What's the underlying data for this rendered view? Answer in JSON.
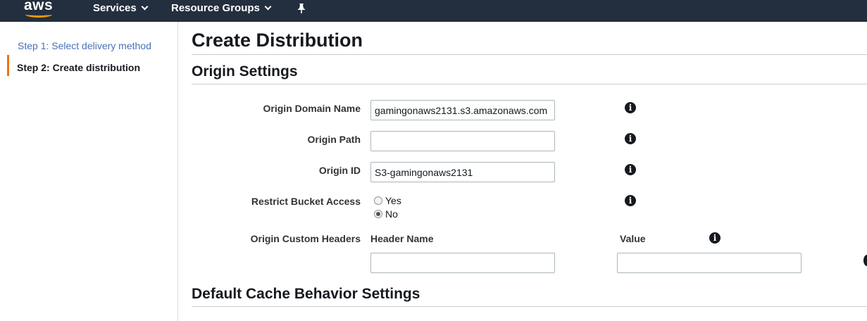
{
  "nav": {
    "logo": "aws",
    "services": "Services",
    "resource_groups": "Resource Groups"
  },
  "sidebar": {
    "steps": [
      {
        "label": "Step 1: Select delivery method"
      },
      {
        "label": "Step 2: Create distribution"
      }
    ]
  },
  "page": {
    "title": "Create Distribution"
  },
  "origin_settings": {
    "title": "Origin Settings",
    "origin_domain_name": {
      "label": "Origin Domain Name",
      "value": "gamingonaws2131.s3.amazonaws.com"
    },
    "origin_path": {
      "label": "Origin Path",
      "value": ""
    },
    "origin_id": {
      "label": "Origin ID",
      "value": "S3-gamingonaws2131"
    },
    "restrict_bucket_access": {
      "label": "Restrict Bucket Access",
      "options": [
        "Yes",
        "No"
      ],
      "selected": "No"
    },
    "custom_headers": {
      "label": "Origin Custom Headers",
      "header_name_label": "Header Name",
      "value_label": "Value",
      "header_name_value": "",
      "value_value": ""
    }
  },
  "default_cache": {
    "title": "Default Cache Behavior Settings"
  },
  "colors": {
    "nav_bg": "#232f3e",
    "accent": "#ec7211",
    "link": "#4a72b8"
  }
}
